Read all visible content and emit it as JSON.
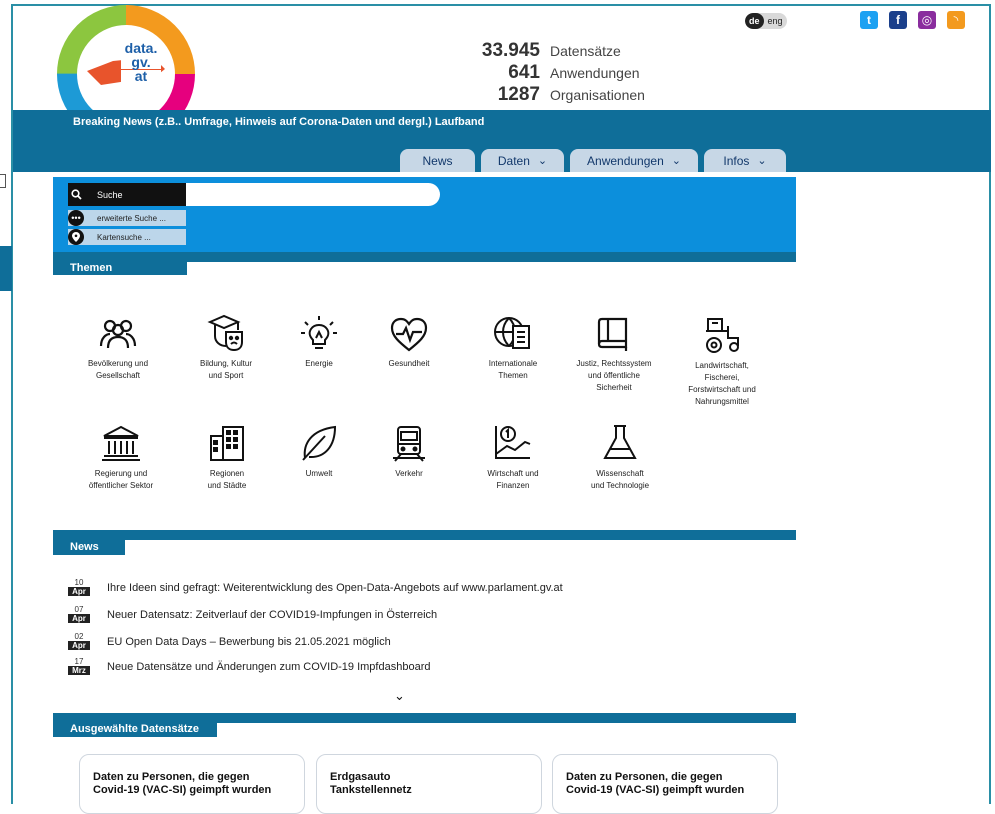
{
  "header": {
    "logo": {
      "line1": "data.",
      "line2": "gv.",
      "line3": "at"
    },
    "stats": [
      {
        "value": "33.945",
        "label": "Datensätze"
      },
      {
        "value": "641",
        "label": "Anwendungen"
      },
      {
        "value": "1287",
        "label": "Organisationen"
      }
    ],
    "lang": {
      "active": "de",
      "other": "eng"
    },
    "social": [
      {
        "icon": "twitter-icon",
        "color": "#1da1f2",
        "glyph": "t"
      },
      {
        "icon": "facebook-icon",
        "color": "#1b3f8b",
        "glyph": "f"
      },
      {
        "icon": "instagram-icon",
        "color": "#8a2d9e",
        "glyph": "◎"
      },
      {
        "icon": "rss-icon",
        "color": "#f39a1e",
        "glyph": "◝"
      }
    ],
    "breaking": "Breaking News (z.B.. Umfrage, Hinweis auf Corona-Daten und dergl.) Laufband"
  },
  "nav": {
    "tabs": [
      {
        "label": "News",
        "chevron": ""
      },
      {
        "label": "Daten",
        "chevron": "⌄"
      },
      {
        "label": "Anwendungen",
        "chevron": "⌄"
      },
      {
        "label": "Infos",
        "chevron": "⌄"
      }
    ]
  },
  "search": {
    "label": "Suche",
    "placeholder": "",
    "advanced": "erweiterte Suche ...",
    "map": "Kartensuche ..."
  },
  "themes": {
    "title": "Themen",
    "items": [
      {
        "label1": "Bevölkerung und",
        "label2": "Gesellschaft",
        "label3": "",
        "label4": "",
        "icon": "people-icon"
      },
      {
        "label1": "Bildung, Kultur",
        "label2": "und Sport",
        "label3": "",
        "label4": "",
        "icon": "education-culture-icon"
      },
      {
        "label1": "Energie",
        "label2": "",
        "label3": "",
        "label4": "",
        "icon": "lightbulb-icon"
      },
      {
        "label1": "Gesundheit",
        "label2": "",
        "label3": "",
        "label4": "",
        "icon": "heart-pulse-icon"
      },
      {
        "label1": "Internationale",
        "label2": "Themen",
        "label3": "",
        "label4": "",
        "icon": "globe-document-icon"
      },
      {
        "label1": "Justiz, Rechtssystem",
        "label2": "und öffentliche",
        "label3": "Sicherheit",
        "label4": "",
        "icon": "law-book-icon"
      },
      {
        "label1": "Landwirtschaft,",
        "label2": "Fischerei,",
        "label3": "Forstwirtschaft und",
        "label4": "Nahrungsmittel",
        "icon": "tractor-icon"
      },
      {
        "label1": "Regierung und",
        "label2": "öffentlicher Sektor",
        "label3": "",
        "label4": "",
        "icon": "government-building-icon"
      },
      {
        "label1": "Regionen",
        "label2": "und Städte",
        "label3": "",
        "label4": "",
        "icon": "city-buildings-icon"
      },
      {
        "label1": "Umwelt",
        "label2": "",
        "label3": "",
        "label4": "",
        "icon": "leaf-icon"
      },
      {
        "label1": "Verkehr",
        "label2": "",
        "label3": "",
        "label4": "",
        "icon": "train-icon"
      },
      {
        "label1": "Wirtschaft und",
        "label2": "Finanzen",
        "label3": "",
        "label4": "",
        "icon": "finance-chart-icon"
      },
      {
        "label1": "Wissenschaft",
        "label2": "und Technologie",
        "label3": "",
        "label4": "",
        "icon": "flask-icon"
      }
    ]
  },
  "news": {
    "title": "News",
    "items": [
      {
        "day": "10",
        "month": "Apr",
        "text": "Ihre Ideen sind gefragt: Weiterentwicklung des Open-Data-Angebots auf www.parlament.gv.at"
      },
      {
        "day": "07",
        "month": "Apr",
        "text": "Neuer Datensatz: Zeitverlauf der COVID19-Impfungen in Österreich"
      },
      {
        "day": "02",
        "month": "Apr",
        "text": "EU Open Data Days – Bewerbung bis 21.05.2021 möglich"
      },
      {
        "day": "17",
        "month": "Mrz",
        "text": "Neue Datensätze und Änderungen zum COVID-19 Impfdashboard"
      }
    ],
    "more": "⌄"
  },
  "featured": {
    "title": "Ausgewählte Datensätze",
    "cards": [
      {
        "line1": "Daten zu Personen, die gegen",
        "line2": "Covid-19 (VAC-SI) geimpft wurden"
      },
      {
        "line1": "Erdgasauto",
        "line2": "Tankstellennetz"
      },
      {
        "line1": "Daten zu Personen, die gegen",
        "line2": "Covid-19 (VAC-SI) geimpft wurden"
      }
    ]
  }
}
